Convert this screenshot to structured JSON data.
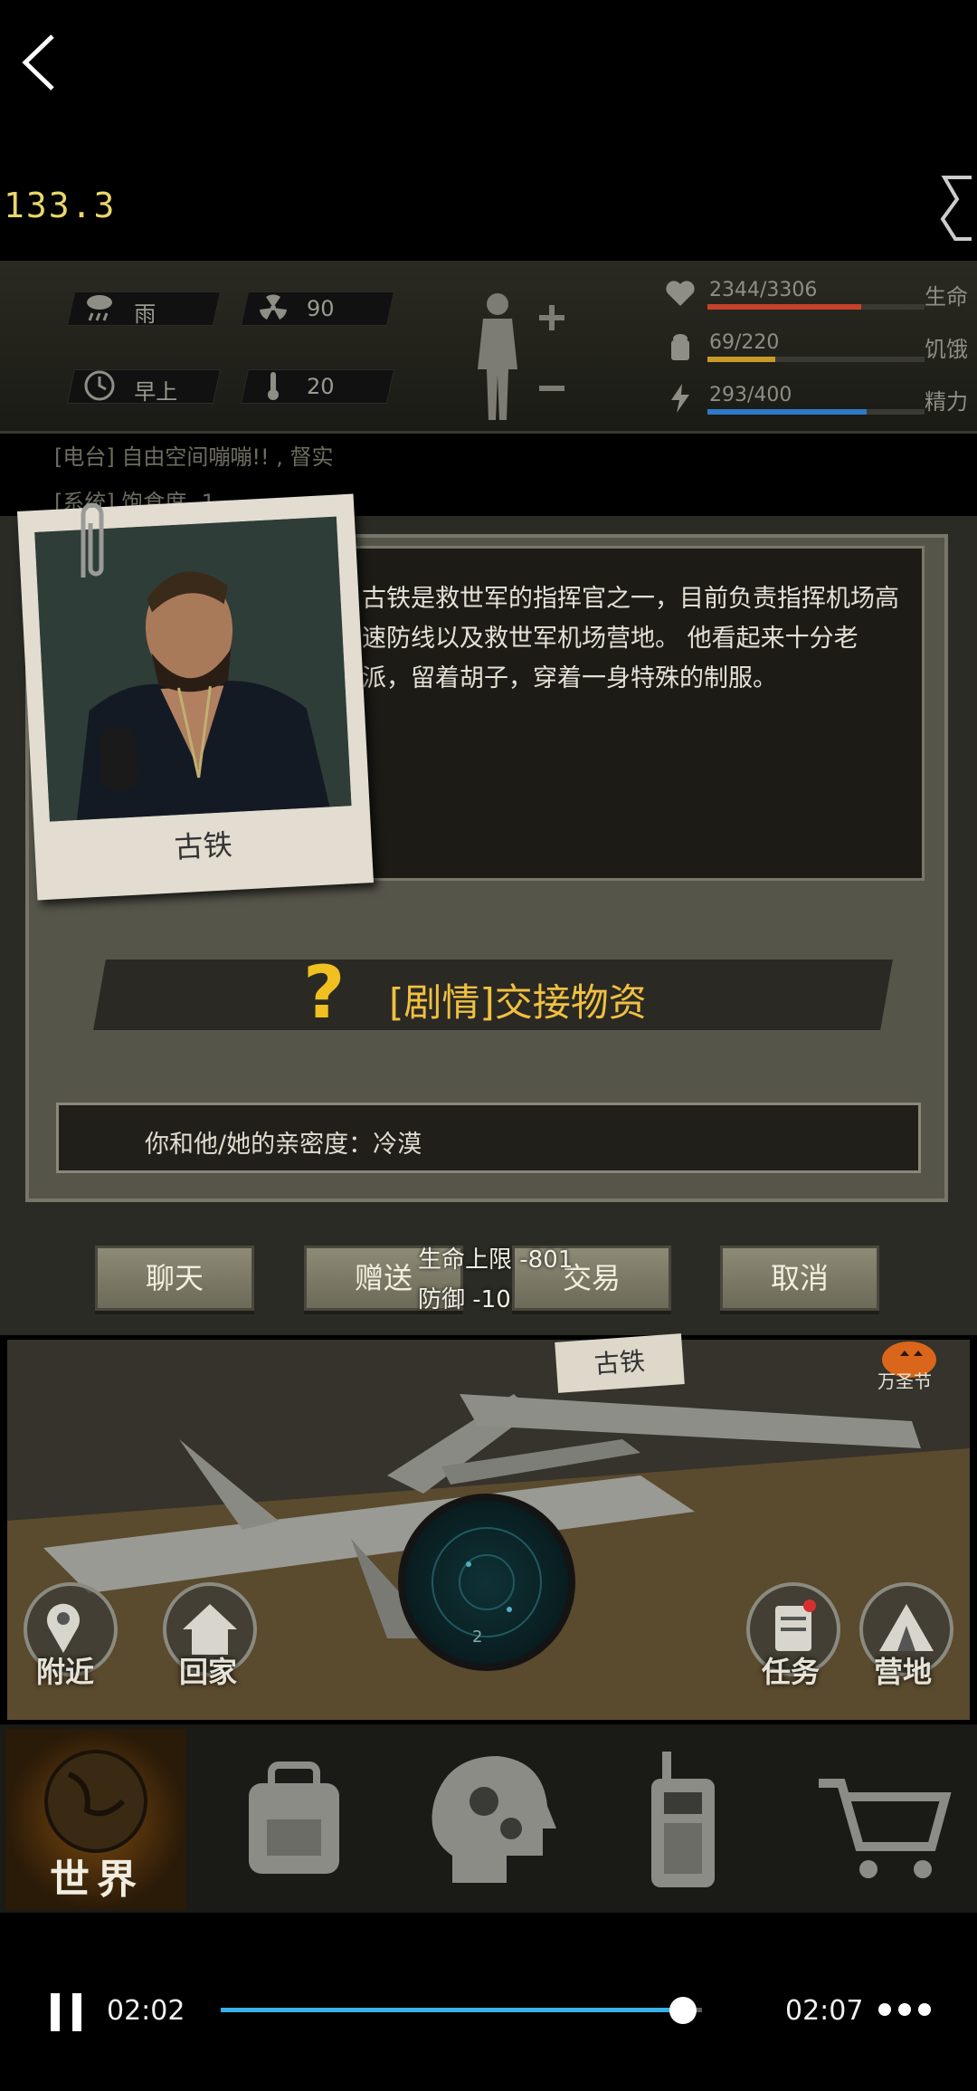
{
  "top": {
    "coord": "133.3"
  },
  "hud": {
    "weather": "雨",
    "radiation": "90",
    "time_of_day": "早上",
    "temperature": "20",
    "stats": [
      {
        "name": "生命",
        "value": "2344/3306",
        "level": 0.709,
        "color": "#c8422a"
      },
      {
        "name": "饥饿",
        "value": "69/220",
        "level": 0.314,
        "color": "#c89a28"
      },
      {
        "name": "精力",
        "value": "293/400",
        "level": 0.7325,
        "color": "#2e7ac8"
      }
    ]
  },
  "log": {
    "line1": "[电台] 自由空间嘣嘣!! , 督实",
    "line2": "[系统] 饱食度 -1"
  },
  "npc": {
    "name": "古铁",
    "description": "古铁是救世军的指挥官之一，目前负责指挥机场高速防线以及救世军机场营地。 他看起来十分老派，留着胡子，穿着一身特殊的制服。",
    "quest_label": "[剧情]交接物资",
    "relationship": "你和他/她的亲密度：冷漠"
  },
  "actions": {
    "chat": "聊天",
    "gift": "赠送",
    "trade": "交易",
    "cancel": "取消"
  },
  "effects": {
    "hp_limit": "生命上限 -801",
    "defense": "防御 -10"
  },
  "map": {
    "npc_tag": "古铁",
    "event": "万圣节",
    "nearby": "附近",
    "home": "回家",
    "tasks": "任务",
    "camp": "营地",
    "radar_level": "2"
  },
  "nav": {
    "world": "世界"
  },
  "video": {
    "current_time": "02:02",
    "total_time": "02:07",
    "progress": 0.96
  }
}
